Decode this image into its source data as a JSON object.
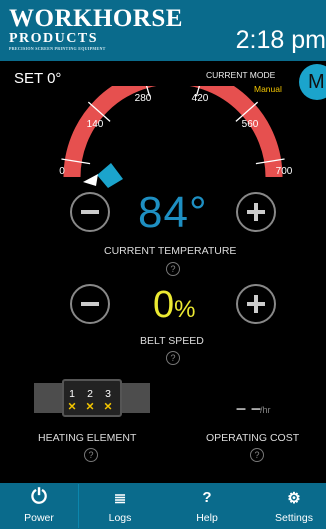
{
  "header": {
    "brand_line1": "WORKHORSE",
    "brand_line2": "PRODUCTS",
    "brand_line3": "PRECISION SCREEN PRINTING EQUIPMENT",
    "time": "2:18 pm"
  },
  "setpoint": {
    "label": "SET 0°"
  },
  "mode": {
    "title": "CURRENT MODE",
    "value": "Manual",
    "badge": "M"
  },
  "gauge": {
    "ticks": [
      "0",
      "140",
      "280",
      "420",
      "560",
      "700"
    ],
    "min": 0,
    "max": 700,
    "current": 0,
    "colors": {
      "arc": "#e6504f",
      "pointer": "#1ba4cc"
    }
  },
  "temperature": {
    "value": "84°",
    "label": "CURRENT TEMPERATURE"
  },
  "belt": {
    "value": "0",
    "unit": "%",
    "label": "BELT SPEED"
  },
  "heating": {
    "label": "HEATING ELEMENT",
    "zones": [
      {
        "n": "1",
        "mark": "✕"
      },
      {
        "n": "2",
        "mark": "✕"
      },
      {
        "n": "3",
        "mark": "✕"
      }
    ]
  },
  "cost": {
    "value": "– –",
    "unit": "/hr",
    "label": "OPERATING COST"
  },
  "help_mark": "?",
  "nav": [
    {
      "id": "power",
      "label": "Power",
      "icon": "power-icon",
      "glyph": "⏻"
    },
    {
      "id": "logs",
      "label": "Logs",
      "icon": "logs-icon",
      "glyph": "≣"
    },
    {
      "id": "help",
      "label": "Help",
      "icon": "question-icon",
      "glyph": "?"
    },
    {
      "id": "settings",
      "label": "Settings",
      "icon": "gears-icon",
      "glyph": "⚙"
    }
  ],
  "colors": {
    "header": "#0a6b8c",
    "accent": "#1ba4cc",
    "temp": "#1e8fc2",
    "speed": "#ecea32",
    "mode": "#f2c500"
  }
}
